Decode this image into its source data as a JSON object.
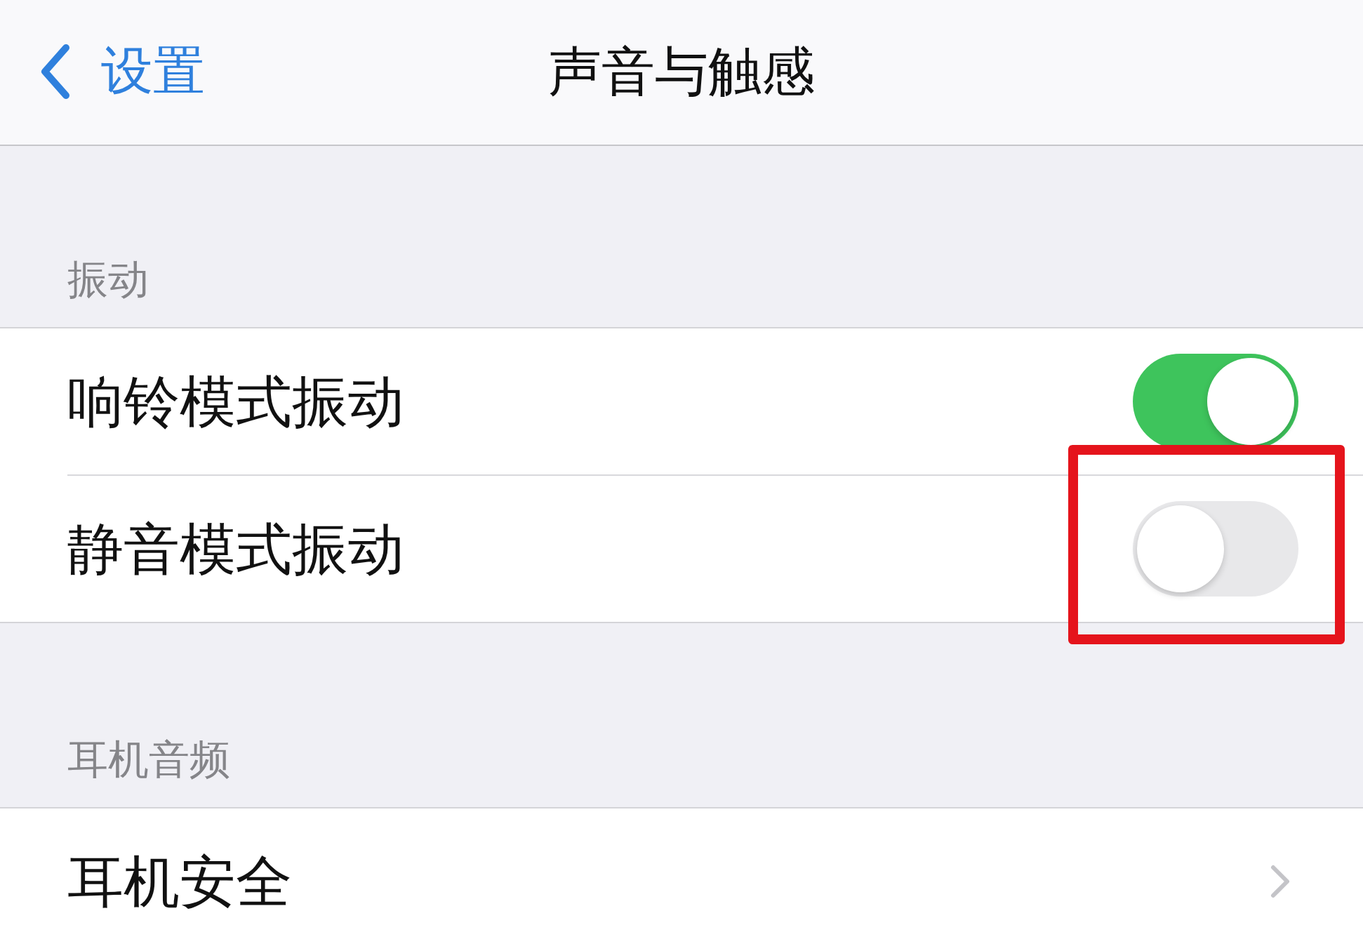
{
  "nav_bar": {
    "back_label": "设置",
    "title": "声音与触感"
  },
  "sections": [
    {
      "header": "振动",
      "rows": [
        {
          "kind": "toggle",
          "label": "响铃模式振动",
          "on": true,
          "highlighted": false
        },
        {
          "kind": "toggle",
          "label": "静音模式振动",
          "on": false,
          "highlighted": true
        }
      ]
    },
    {
      "header": "耳机音频",
      "rows": [
        {
          "kind": "link",
          "label": "耳机安全",
          "highlighted": false
        }
      ]
    }
  ]
}
